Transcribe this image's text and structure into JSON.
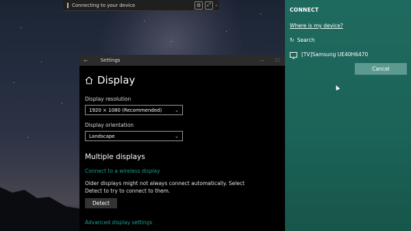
{
  "cast_bar": {
    "title": "Connecting to your device"
  },
  "settings": {
    "window_title": "Settings",
    "page_title": "Display",
    "resolution_label": "Display resolution",
    "resolution_value": "1920 × 1080 (Recommended)",
    "orientation_label": "Display orientation",
    "orientation_value": "Landscape",
    "multiple_displays_title": "Multiple displays",
    "wireless_link": "Connect to a wireless display",
    "detect_help": "Older displays might not always connect automatically. Select Detect to try to connect to them.",
    "detect_button": "Detect",
    "advanced_link": "Advanced display settings"
  },
  "connect": {
    "title": "CONNECT",
    "where_link": "Where is my device?",
    "search_label": "Search",
    "device_name": "[TV]Samsung UE40H6470",
    "cancel_label": "Cancel"
  },
  "colors": {
    "connect_pane": "#1f6a5e",
    "link_accent": "#1c9e8e",
    "cancel_button": "#5c9a90"
  },
  "icons": [
    "home-icon",
    "search-icon",
    "tv-icon",
    "back-arrow-icon",
    "cursor-icon"
  ]
}
